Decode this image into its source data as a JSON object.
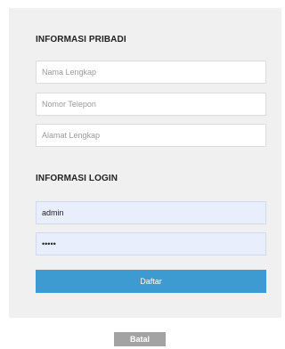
{
  "personal": {
    "title": "INFORMASI PRIBADI",
    "full_name_placeholder": "Nama Lengkap",
    "phone_placeholder": "Nomor Telepon",
    "address_placeholder": "Alamat Lengkap"
  },
  "login": {
    "title": "INFORMASI LOGIN",
    "username_value": "admin",
    "password_value": "•••••"
  },
  "actions": {
    "register_label": "Daftar",
    "cancel_label": "Batal"
  },
  "colors": {
    "primary": "#3d9bd1",
    "cancel": "#a3a3a3",
    "card_background": "#f0f0f0",
    "filled_field": "#e8eefb"
  }
}
